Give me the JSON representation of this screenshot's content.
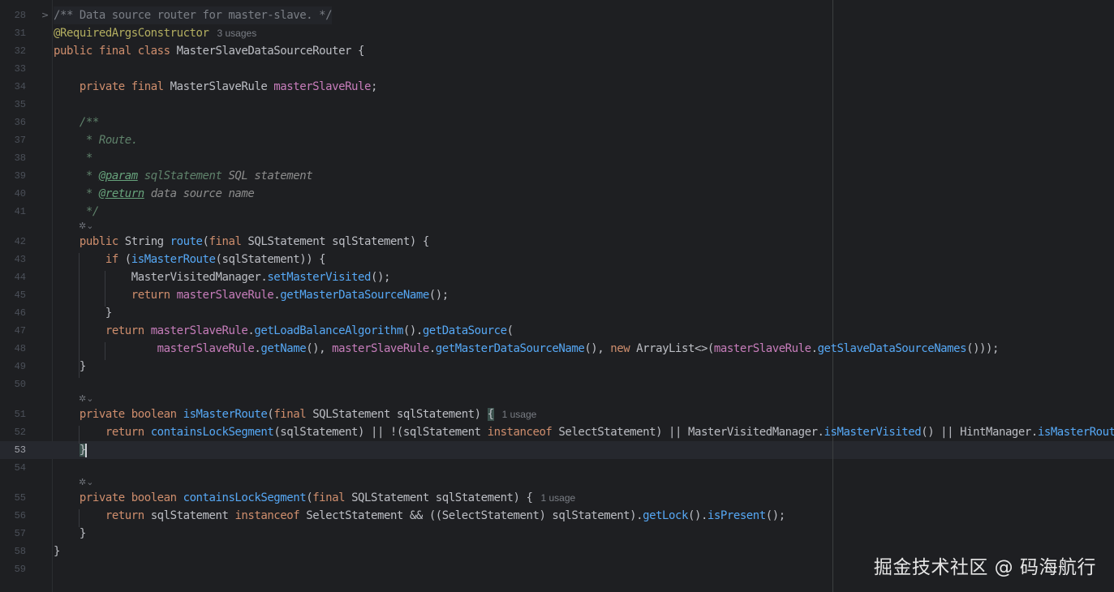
{
  "editor": {
    "accent_colors": {
      "keyword": "#cf8e6d",
      "annotation": "#b3ae60",
      "field": "#c77dbb",
      "method": "#56a8f5",
      "comment": "#7a7e85",
      "text": "#bcbec4",
      "background": "#1e1f22"
    },
    "current_line": "53",
    "lines": [
      {
        "num": "28",
        "segments": [
          {
            "t": "/** Data source router for master-slave. */",
            "c": "cmt"
          }
        ],
        "fold": ">"
      },
      {
        "num": "31",
        "segments": [
          {
            "t": "@RequiredArgsConstructor",
            "c": "ann"
          }
        ],
        "hint": "3 usages"
      },
      {
        "num": "32",
        "segments": [
          {
            "t": "public final class ",
            "c": "kw"
          },
          {
            "t": "MasterSlaveDataSourceRouter {"
          }
        ]
      },
      {
        "num": "33",
        "segments": []
      },
      {
        "num": "34",
        "segments": [
          {
            "t": "    "
          },
          {
            "t": "private final ",
            "c": "kw"
          },
          {
            "t": "MasterSlaveRule "
          },
          {
            "t": "masterSlaveRule",
            "c": "fld"
          },
          {
            "t": ";"
          }
        ]
      },
      {
        "num": "35",
        "segments": []
      },
      {
        "num": "36",
        "segments": [
          {
            "t": "    /**",
            "c": "doc"
          }
        ]
      },
      {
        "num": "37",
        "segments": [
          {
            "t": "     * Route.",
            "c": "doc"
          }
        ]
      },
      {
        "num": "38",
        "segments": [
          {
            "t": "     *",
            "c": "doc"
          }
        ]
      },
      {
        "num": "39",
        "segments": [
          {
            "t": "     * ",
            "c": "doc"
          },
          {
            "t": "@param",
            "c": "dtag"
          },
          {
            "t": " sqlStatement",
            "c": "doc"
          },
          {
            "t": " SQL statement",
            "c": "dtxt"
          }
        ]
      },
      {
        "num": "40",
        "segments": [
          {
            "t": "     * ",
            "c": "doc"
          },
          {
            "t": "@return",
            "c": "dtag"
          },
          {
            "t": " data source name",
            "c": "dtxt"
          }
        ]
      },
      {
        "num": "41",
        "segments": [
          {
            "t": "     */",
            "c": "doc"
          }
        ]
      },
      {
        "num": "42",
        "segments": [
          {
            "t": "    "
          },
          {
            "t": "public ",
            "c": "kw"
          },
          {
            "t": "String "
          },
          {
            "t": "route",
            "c": "mth"
          },
          {
            "t": "("
          },
          {
            "t": "final ",
            "c": "kw"
          },
          {
            "t": "SQLStatement sqlStatement) {"
          }
        ]
      },
      {
        "num": "43",
        "segments": [
          {
            "t": "        "
          },
          {
            "t": "if ",
            "c": "kw"
          },
          {
            "t": "("
          },
          {
            "t": "isMasterRoute",
            "c": "mth"
          },
          {
            "t": "(sqlStatement)) {"
          }
        ]
      },
      {
        "num": "44",
        "segments": [
          {
            "t": "            MasterVisitedManager."
          },
          {
            "t": "setMasterVisited",
            "c": "mth"
          },
          {
            "t": "();"
          }
        ]
      },
      {
        "num": "45",
        "segments": [
          {
            "t": "            "
          },
          {
            "t": "return ",
            "c": "kw"
          },
          {
            "t": "masterSlaveRule",
            "c": "fld"
          },
          {
            "t": "."
          },
          {
            "t": "getMasterDataSourceName",
            "c": "mth"
          },
          {
            "t": "();"
          }
        ]
      },
      {
        "num": "46",
        "segments": [
          {
            "t": "        }"
          }
        ]
      },
      {
        "num": "47",
        "segments": [
          {
            "t": "        "
          },
          {
            "t": "return ",
            "c": "kw"
          },
          {
            "t": "masterSlaveRule",
            "c": "fld"
          },
          {
            "t": "."
          },
          {
            "t": "getLoadBalanceAlgorithm",
            "c": "mth"
          },
          {
            "t": "()."
          },
          {
            "t": "getDataSource",
            "c": "mth"
          },
          {
            "t": "("
          }
        ]
      },
      {
        "num": "48",
        "segments": [
          {
            "t": "                "
          },
          {
            "t": "masterSlaveRule",
            "c": "fld"
          },
          {
            "t": "."
          },
          {
            "t": "getName",
            "c": "mth"
          },
          {
            "t": "(), "
          },
          {
            "t": "masterSlaveRule",
            "c": "fld"
          },
          {
            "t": "."
          },
          {
            "t": "getMasterDataSourceName",
            "c": "mth"
          },
          {
            "t": "(), "
          },
          {
            "t": "new ",
            "c": "kw"
          },
          {
            "t": "ArrayList<>("
          },
          {
            "t": "masterSlaveRule",
            "c": "fld"
          },
          {
            "t": "."
          },
          {
            "t": "getSlaveDataSourceNames",
            "c": "mth"
          },
          {
            "t": "()));"
          }
        ]
      },
      {
        "num": "49",
        "segments": [
          {
            "t": "    }"
          }
        ]
      },
      {
        "num": "50",
        "segments": []
      },
      {
        "num": "51",
        "segments": [
          {
            "t": "    "
          },
          {
            "t": "private boolean ",
            "c": "kw"
          },
          {
            "t": "isMasterRoute",
            "c": "mth"
          },
          {
            "t": "("
          },
          {
            "t": "final ",
            "c": "kw"
          },
          {
            "t": "SQLStatement sqlStatement) "
          },
          {
            "t": "{",
            "c": "match"
          }
        ],
        "hint": "1 usage"
      },
      {
        "num": "52",
        "segments": [
          {
            "t": "        "
          },
          {
            "t": "return ",
            "c": "kw"
          },
          {
            "t": "containsLockSegment",
            "c": "mth"
          },
          {
            "t": "(sqlStatement) || !(sqlStatement "
          },
          {
            "t": "instanceof ",
            "c": "kw"
          },
          {
            "t": "SelectStatement) || MasterVisitedManager."
          },
          {
            "t": "isMasterVisited",
            "c": "mth"
          },
          {
            "t": "() || HintManager."
          },
          {
            "t": "isMasterRouteOnly",
            "c": "mth"
          },
          {
            "t": "();"
          }
        ]
      },
      {
        "num": "53",
        "segments": [
          {
            "t": "    "
          },
          {
            "t": "}",
            "c": "match"
          },
          {
            "t": "",
            "c": "caret"
          }
        ]
      },
      {
        "num": "54",
        "segments": []
      },
      {
        "num": "55",
        "segments": [
          {
            "t": "    "
          },
          {
            "t": "private boolean ",
            "c": "kw"
          },
          {
            "t": "containsLockSegment",
            "c": "mth"
          },
          {
            "t": "("
          },
          {
            "t": "final ",
            "c": "kw"
          },
          {
            "t": "SQLStatement sqlStatement) {"
          }
        ],
        "hint": "1 usage"
      },
      {
        "num": "56",
        "segments": [
          {
            "t": "        "
          },
          {
            "t": "return ",
            "c": "kw"
          },
          {
            "t": "sqlStatement "
          },
          {
            "t": "instanceof ",
            "c": "kw"
          },
          {
            "t": "SelectStatement && ((SelectStatement) sqlStatement)."
          },
          {
            "t": "getLock",
            "c": "mth"
          },
          {
            "t": "()."
          },
          {
            "t": "isPresent",
            "c": "mth"
          },
          {
            "t": "();"
          }
        ]
      },
      {
        "num": "57",
        "segments": [
          {
            "t": "    }"
          }
        ]
      },
      {
        "num": "58",
        "segments": [
          {
            "t": "}"
          }
        ]
      },
      {
        "num": "59",
        "segments": []
      }
    ],
    "inlay_icons": [
      "ai-assist-icon",
      "ai-assist-icon",
      "ai-assist-icon"
    ]
  },
  "watermark": {
    "text": "掘金技术社区 @ 码海航行"
  }
}
